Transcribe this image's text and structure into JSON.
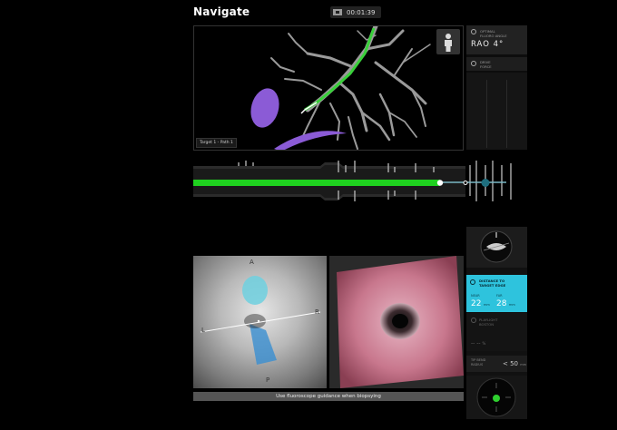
{
  "header": {
    "title": "Navigate",
    "timer": "00:01:39"
  },
  "view3d": {
    "target_label": "Target 1 - Path 1",
    "airway_color": "#bdbdbd",
    "path_color": "#39d03a",
    "target_color": "#8b5bd6",
    "figure_icon": "person-icon"
  },
  "fluoro": {
    "label_line1": "OPTIMAL",
    "label_line2": "FLUORO ANGLE",
    "value": "RAO  4°"
  },
  "drive": {
    "label_line1": "DRIVE",
    "label_line2": "FORCE"
  },
  "path_track": {
    "progress": 0.8,
    "bar_color": "#1fd11f",
    "target_marker_color": "#1f6f7f"
  },
  "endoscope_left": {
    "marker_top": "A",
    "marker_bottom": "P",
    "marker_left": "L",
    "marker_right": "R"
  },
  "footer_hint": "Use fluoroscope guidance when biopsying",
  "distance": {
    "label_line1": "DISTANCE TO",
    "label_line2": "TARGET EDGE",
    "near_label": "NEAR",
    "near_value": "22",
    "near_unit": "mm",
    "far_label": "FAR",
    "far_value": "28",
    "far_unit": "mm",
    "color": "#2ec3dd"
  },
  "playlight": {
    "label_line1": "PLAYLIGHT",
    "label_line2": "BOSTON",
    "value": "-- --",
    "unit": "%"
  },
  "tip": {
    "label_line1": "TIP BEND",
    "label_line2": "RADIUS",
    "value": "< 50",
    "unit": "mm"
  }
}
